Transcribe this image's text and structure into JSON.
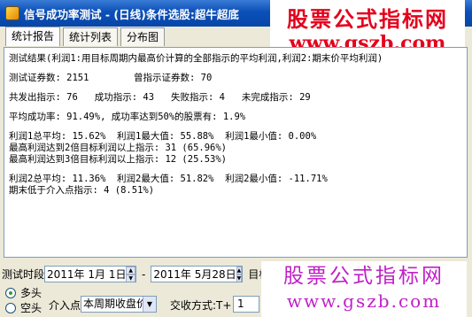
{
  "window": {
    "title": "信号成功率测试 - (日线)条件选股:超牛超底"
  },
  "watermark_top": {
    "cn": "股票公式指标网",
    "url": "www.gszb.com"
  },
  "tabs": [
    {
      "label": "统计报告",
      "active": true
    },
    {
      "label": "统计列表",
      "active": false
    },
    {
      "label": "分布图",
      "active": false
    }
  ],
  "report": {
    "l1": "测试结果(利润1:用目标周期内最高价计算的全部指示的平均利润,利润2:期末价平均利润)",
    "l2": "测试证券数: 2151        曾指示证券数: 70",
    "l3": "共发出指示: 76   成功指示: 43   失败指示: 4   未完成指示: 29",
    "l4": "平均成功率: 91.49%, 成功率达到50%的股票有: 1.9%",
    "l5": "利润1总平均: 15.62%  利润1最大值: 55.88%  利润1最小值: 0.00%",
    "l6": "最高利润达到2倍目标利润以上指示: 31 (65.96%)",
    "l7": "最高利润达到3倍目标利润以上指示: 12 (25.53%)",
    "l8": "利润2总平均: 11.36%  利润2最大值: 51.82%  利润2最小值: -11.71%",
    "l9": "期末低于介入点指示: 4 (8.51%)"
  },
  "controls": {
    "period_label": "测试时段",
    "start_date": "2011年 1月 1日",
    "separator": "-",
    "end_date": "2011年 5月28日",
    "target_label": "目标",
    "long_label": "多头",
    "short_label": "空头",
    "entry_label": "介入点",
    "entry_value": "本周期收盘价",
    "trade_label": "交收方式:T+",
    "trade_value": "1"
  },
  "watermark_bottom": {
    "cn": "股票公式指标网",
    "url": "www.gszb.com"
  },
  "colors": {
    "titlebar": "#0a4fb8",
    "watermark_red": "#e4001b",
    "watermark_purple": "#c020c8"
  }
}
